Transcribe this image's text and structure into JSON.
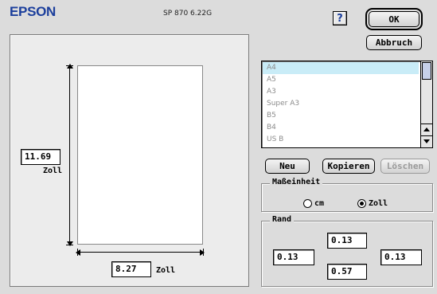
{
  "header": {
    "brand": "EPSON",
    "version": "SP 870 6.22G",
    "help_glyph": "?",
    "ok_label": "OK",
    "cancel_label": "Abbruch"
  },
  "preview": {
    "height_value": "11.69",
    "height_unit": "Zoll",
    "width_value": "8.27",
    "width_unit": "Zoll"
  },
  "paper_list": {
    "items": [
      "A4",
      "A5",
      "A3",
      "Super A3",
      "B5",
      "B4",
      "US B"
    ],
    "selected": "A4"
  },
  "actions": {
    "new_label": "Neu",
    "copy_label": "Kopieren",
    "delete_label": "Löschen"
  },
  "units": {
    "title": "Maßeinheit",
    "options": [
      "cm",
      "Zoll"
    ],
    "selected": "Zoll"
  },
  "margins": {
    "title": "Rand",
    "top": "0.13",
    "left": "0.13",
    "right": "0.13",
    "bottom": "0.57"
  }
}
